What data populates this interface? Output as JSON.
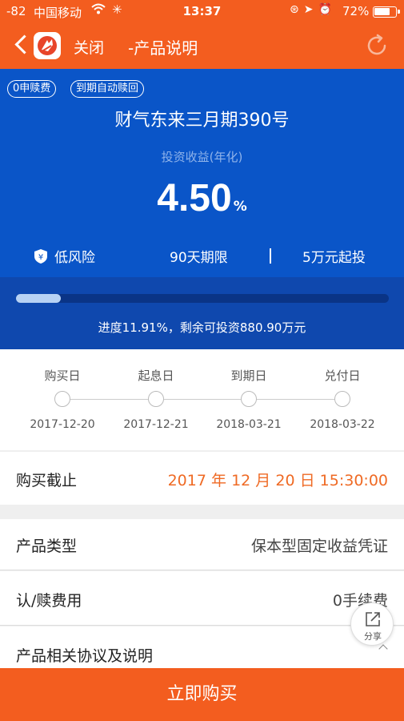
{
  "status_bar": {
    "signal": "-82",
    "carrier": "中国移动",
    "time": "13:37",
    "battery": "72%",
    "battery_level": 0.72
  },
  "nav": {
    "close_label": "关闭",
    "title": "-产品说明"
  },
  "product": {
    "tags": [
      "0申赎费",
      "到期自动赎回"
    ],
    "name": "财气东来三月期390号",
    "yield_label": "投资收益(年化)",
    "rate": "4.50",
    "rate_unit": "%",
    "features": [
      "低风险",
      "90天期限",
      "5万元起投"
    ]
  },
  "progress": {
    "percent": 11.91,
    "text": "进度11.91%，剩余可投资880.90万元"
  },
  "timeline": [
    {
      "label": "购买日",
      "date": "2017-12-20"
    },
    {
      "label": "起息日",
      "date": "2017-12-21"
    },
    {
      "label": "到期日",
      "date": "2018-03-21"
    },
    {
      "label": "兑付日",
      "date": "2018-03-22"
    }
  ],
  "purchase_deadline": {
    "label": "购买截止",
    "year": "2017",
    "year_unit": "年",
    "month": "12",
    "month_unit": "月",
    "day": "20",
    "day_unit": "日",
    "time": "15:30:00"
  },
  "details": {
    "type_label": "产品类型",
    "type_value": "保本型固定收益凭证",
    "fee_label": "认/赎费用",
    "fee_value": "0手续费",
    "docs_label": "产品相关协议及说明"
  },
  "share": {
    "label": "分享"
  },
  "buy_button": "立即购买",
  "colors": {
    "accent": "#f35d1f",
    "hero_blue": "#0a55c8",
    "deadline_orange": "#ef6a24"
  }
}
